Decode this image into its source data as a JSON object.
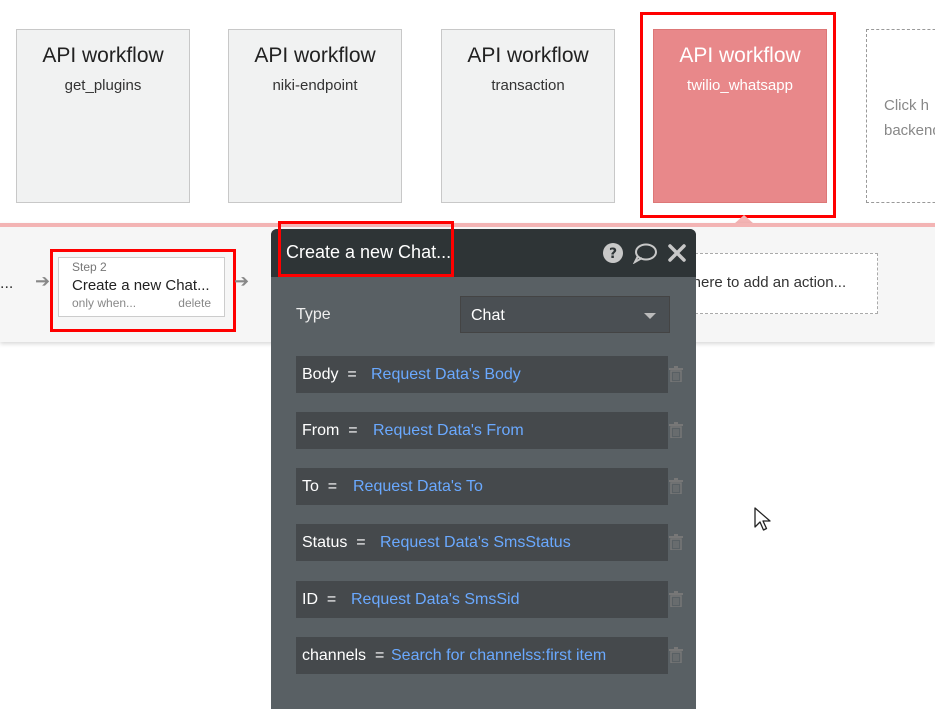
{
  "workflows": [
    {
      "title": "API workflow",
      "name": "get_plugins",
      "active": false
    },
    {
      "title": "API workflow",
      "name": "niki-endpoint",
      "active": false
    },
    {
      "title": "API workflow",
      "name": "transaction",
      "active": false
    },
    {
      "title": "API workflow",
      "name": "twilio_whatsapp",
      "active": true
    }
  ],
  "add_workflow_text_line1": "Click h",
  "add_workflow_text_line2": "backend",
  "strip": {
    "prev_ellipsis": "...",
    "step": {
      "label": "Step 2",
      "title": "Create a new Chat...",
      "condition": "only when...",
      "delete": "delete"
    },
    "add_action": "k here to add an action..."
  },
  "panel": {
    "title": "Create a new Chat...",
    "type_label": "Type",
    "type_value": "Chat",
    "fields": [
      {
        "key": "Body  =",
        "value": "Request Data's Body"
      },
      {
        "key": "From  =",
        "value": "Request Data's From"
      },
      {
        "key": "To  =",
        "value": "Request Data's To"
      },
      {
        "key": "Status  =",
        "value": "Request Data's SmsStatus"
      },
      {
        "key": "ID  =",
        "value": "Request Data's SmsSid"
      },
      {
        "key": "channels  =",
        "value": "Search for channelss:first item"
      }
    ]
  },
  "colors": {
    "active_workflow": "#e8888a",
    "highlight": "#ff0000",
    "panel_bg": "#596064",
    "expression_text": "#6aa9ff"
  }
}
